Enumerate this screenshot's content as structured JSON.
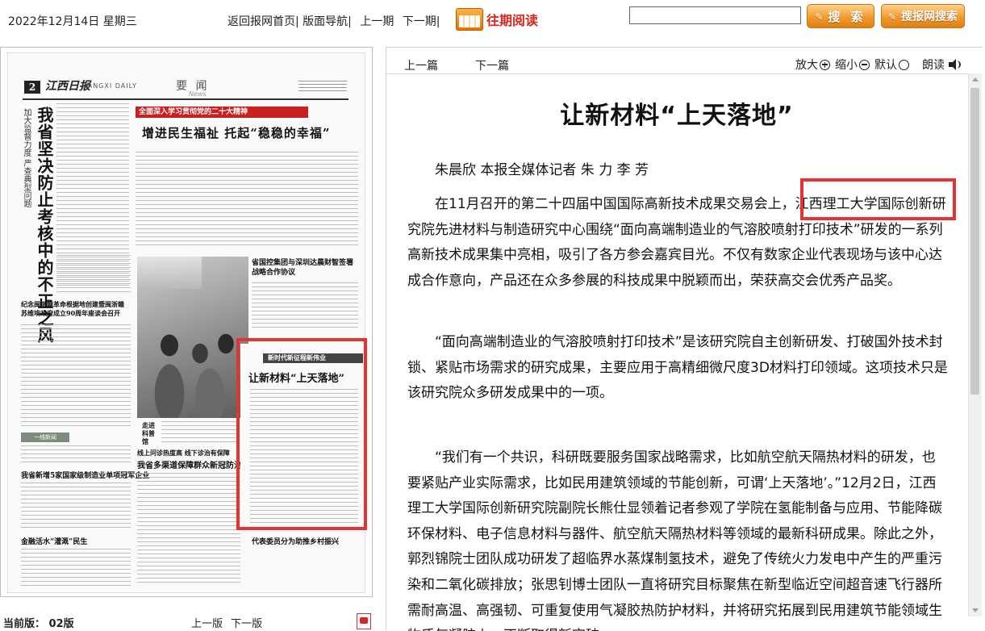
{
  "header": {
    "date": "2022年12月14日 星期三",
    "nav": [
      "返回报网首页",
      "版面导航",
      "上一期",
      "下一期"
    ],
    "past_reading": "往期阅读",
    "search_placeholder": "",
    "search_button": "搜 索",
    "site_search_button": "搜报网搜索"
  },
  "page_preview": {
    "page_number": "2",
    "paper_name": "江西日报",
    "paper_name_en": "JIANGXI DAILY",
    "section": "要 闻",
    "section_en": "News",
    "lead_headline": "我省坚决防止考核中的不正之风",
    "lead_subtitle": "加大监督力度 严查典型问题",
    "top_banner": "全面深入学习贯彻党的二十大精神",
    "main_headline": "增进民生福祉  托起“稳稳的幸福”",
    "story_headline_1": "省国控集团与深圳达晨财智签署战略合作协议",
    "story_headline_2": "纪念闽浙赣革命根据地创建暨闽浙赣苏维埃政府成立90周年座谈会召开",
    "story_headline_3": "我省新增5家国家级制造业单项冠军企业",
    "story_headline_4": "金融活水“灌溉”民生",
    "story_headline_5": "我省多渠道保障群众新冠防治需求",
    "story_headline_6": "线上问诊热度高  线下诊治有保障",
    "story_headline_7": "代表委员分为助推乡村振兴",
    "small_tag": "一线新闻",
    "side_caption": "走进科普馆",
    "highlighted_banner": "新时代新征程新伟业",
    "highlighted_title": "让新材料“上天落地”"
  },
  "footer": {
    "current_edition_label": "当前版：",
    "current_edition": "02版",
    "prev_page": "上一版",
    "next_page": "下一版"
  },
  "article_toolbar": {
    "prev_article": "上一篇",
    "next_article": "下一篇",
    "zoom_in": "放大",
    "zoom_out": "缩小",
    "default": "默认",
    "read_aloud": "朗读"
  },
  "article": {
    "title": "让新材料“上天落地”",
    "byline": "朱晨欣 本报全媒体记者 朱 力 李 芳",
    "paragraphs": [
      "在11月召开的第二十四届中国国际高新技术成果交易会上，江西理工大学国际创新研究院先进材料与制造研究中心围绕“面向高端制造业的气溶胶喷射打印技术”研发的一系列高新技术成果集中亮相，吸引了各方参会嘉宾目光。不仅有数家企业代表现场与该中心达成合作意向，产品还在众多参展的科技成果中脱颖而出，荣获高交会优秀产品奖。",
      "“面向高端制造业的气溶胶喷射打印技术”是该研究院自主创新研发、打破国外技术封锁、紧贴市场需求的研究成果，主要应用于高精细微尺度3D材料打印领域。这项技术只是该研究院众多研发成果中的一项。",
      "“我们有一个共识，科研既要服务国家战略需求，比如航空航天隔热材料的研发，也要紧贴产业实际需求，比如民用建筑领域的节能创新，可谓‘上天落地’。”12月2日，江西理工大学国际创新研究院副院长熊仕显领着记者参观了学院在氢能制备与应用、节能降碳环保材料、电子信息材料与器件、航空航天隔热材料等领域的最新科研成果。除此之外，郭烈锦院士团队成功研发了超临界水蒸煤制氢技术，避免了传统火力发电中产生的严重污染和二氧化碳排放；张思钊博士团队一直将研究目标聚焦在新型临近空间超音速飞行器所需耐高温、高强韧、可重复使用气凝胶热防护材料，并将研究拓展到民用建筑节能领域生物质气凝胶上，不断取得新突破……"
    ]
  },
  "colors": {
    "highlight": "#e53333",
    "accent_orange": "#f39a2d",
    "past_reading_red": "#d9261c"
  }
}
